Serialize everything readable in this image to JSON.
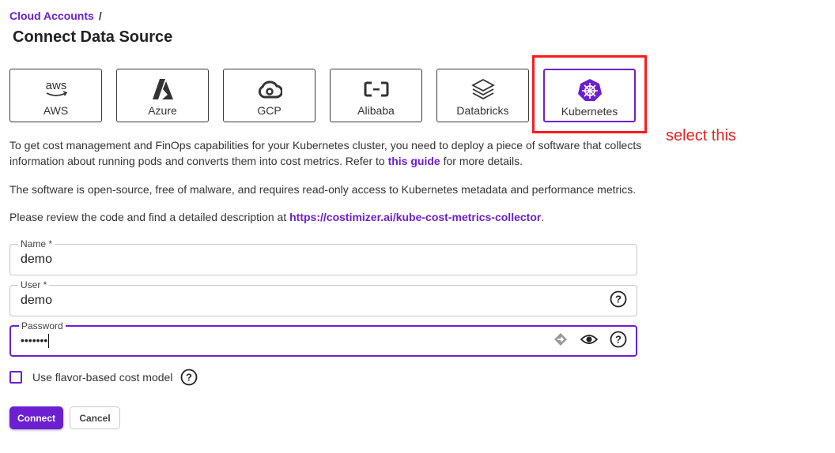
{
  "breadcrumb": {
    "root": "Cloud Accounts",
    "separator": "/"
  },
  "page_title": "Connect Data Source",
  "providers": [
    {
      "label": "AWS",
      "icon": "aws-logo-icon",
      "selected": false
    },
    {
      "label": "Azure",
      "icon": "azure-logo-icon",
      "selected": false
    },
    {
      "label": "GCP",
      "icon": "gcp-cloud-icon",
      "selected": false
    },
    {
      "label": "Alibaba",
      "icon": "alibaba-cloud-icon",
      "selected": false
    },
    {
      "label": "Databricks",
      "icon": "databricks-layers-icon",
      "selected": false
    },
    {
      "label": "Kubernetes",
      "icon": "kubernetes-helm-icon",
      "selected": true
    }
  ],
  "annotation": {
    "text": "select this",
    "color": "#e52222"
  },
  "description": {
    "p1_before": "To get cost management and FinOps capabilities for your Kubernetes cluster, you need to deploy a piece of software that collects information about running pods and converts them into cost metrics. Refer to ",
    "p1_link": "this guide",
    "p1_after": " for more details.",
    "p2": "The software is open-source, free of malware, and requires read-only access to Kubernetes metadata and performance metrics.",
    "p3_before": "Please review the code and find a detailed description at ",
    "p3_link": "https://costimizer.ai/kube-cost-metrics-collector",
    "p3_after": "."
  },
  "form": {
    "name": {
      "label": "Name *",
      "value": "demo"
    },
    "user": {
      "label": "User *",
      "value": "demo"
    },
    "password": {
      "label": "Password",
      "masked_value": "•••••••"
    }
  },
  "checkbox": {
    "label": "Use flavor-based cost model",
    "checked": false
  },
  "buttons": {
    "connect": "Connect",
    "cancel": "Cancel"
  },
  "colors": {
    "accent": "#6b1fd1",
    "annotation": "#ff1a1a"
  }
}
